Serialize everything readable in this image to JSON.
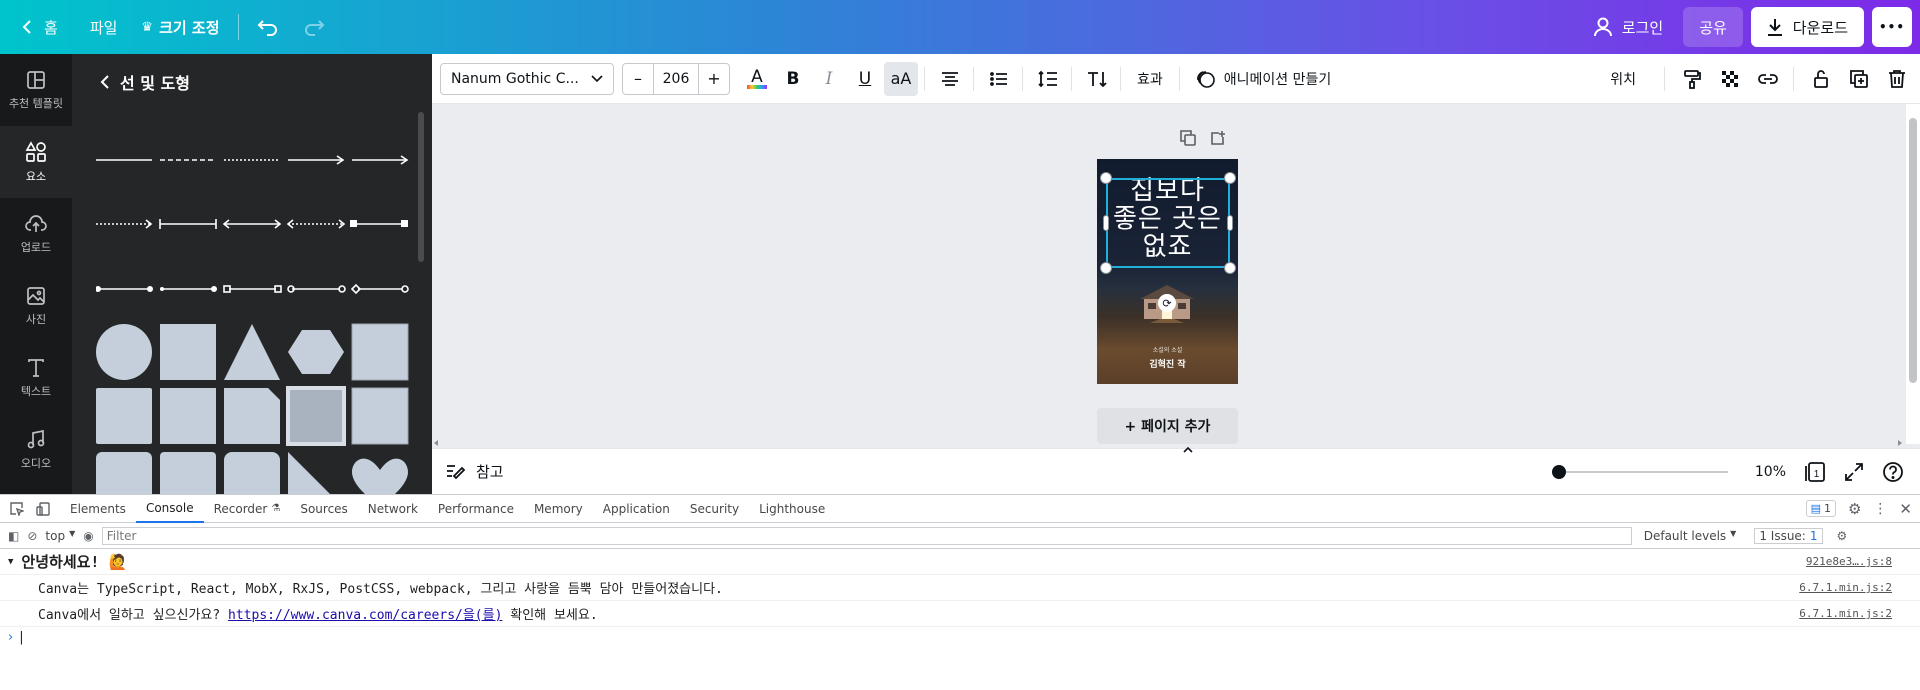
{
  "topbar": {
    "home_label": "홈",
    "file_label": "파일",
    "resize_label": "크기 조정",
    "login_label": "로그인",
    "share_label": "공유",
    "download_label": "다운로드",
    "more_label": "•••"
  },
  "rail": {
    "items": [
      {
        "label": "추천 템플릿",
        "icon": "template-icon"
      },
      {
        "label": "요소",
        "icon": "elements-icon"
      },
      {
        "label": "업로드",
        "icon": "upload-icon"
      },
      {
        "label": "사진",
        "icon": "photo-icon"
      },
      {
        "label": "텍스트",
        "icon": "text-icon"
      },
      {
        "label": "오디오",
        "icon": "audio-icon"
      }
    ]
  },
  "panel": {
    "title": "선 및 도형"
  },
  "toolbar": {
    "font_name": "Nanum Gothic C...",
    "size_minus": "–",
    "font_size": "206",
    "size_plus": "+",
    "bold": "B",
    "italic": "I",
    "underline": "U",
    "case": "aA",
    "effects_label": "효과",
    "animate_label": "애니메이션 만들기",
    "position_label": "위치"
  },
  "canvas": {
    "title_line1": "집보다",
    "title_line2": "좋은 곳은",
    "title_line3": "없죠",
    "caption_small": "소설의 소설",
    "author": "김혁진 작",
    "add_page_label": "+ 페이지 추가"
  },
  "footer": {
    "notes_label": "참고",
    "zoom_value": "10%",
    "zoom_fraction": 0.0,
    "page_count": "1"
  },
  "devtools": {
    "tabs": [
      "Elements",
      "Console",
      "Recorder",
      "Sources",
      "Network",
      "Performance",
      "Memory",
      "Application",
      "Security",
      "Lighthouse"
    ],
    "active_tab": "Console",
    "message_count": "1",
    "context": "top",
    "filter_placeholder": "Filter",
    "levels_label": "Default levels",
    "issues_label": "1 Issue:",
    "issues_count": "1",
    "lines": [
      {
        "text": "안녕하세요! 🙋",
        "src": "921e8e3….js:8"
      },
      {
        "text": "Canva는 TypeScript, React, MobX, RxJS, PostCSS, webpack, 그리고 사랑을 듬뿍 담아 만들어졌습니다.",
        "src": "6.7.1.min.js:2"
      },
      {
        "pre": "Canva에서 일하고 싶으신가요? ",
        "link": "https://www.canva.com/careers/을(를)",
        "post": " 확인해 보세요.",
        "src": "6.7.1.min.js:2"
      }
    ]
  },
  "colors": {
    "gradient_start": "#00c4cc",
    "gradient_end": "#7d2ae8",
    "selection": "#1fb1d9",
    "rail_bg": "#18191b",
    "panel_bg": "#252627"
  }
}
